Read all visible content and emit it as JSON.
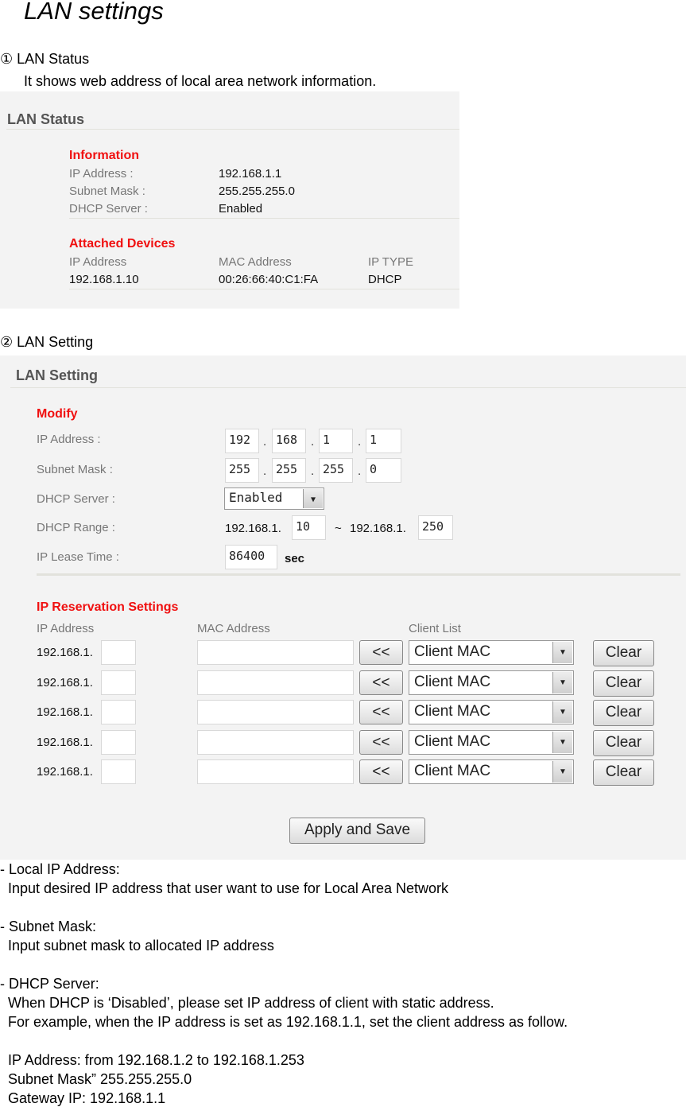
{
  "doc": {
    "title": "LAN settings",
    "sec1": "① LAN Status",
    "sec1_desc": "It shows web address of local area network information.",
    "sec2": "② LAN Setting",
    "notes": [
      "- Local IP Address:",
      "Input desired IP address that user want to use for Local Area Network",
      "- Subnet Mask:",
      "Input subnet mask to allocated IP address",
      "- DHCP Server:",
      "When DHCP is ‘Disabled’, please set IP address of client with static address.",
      "For example, when the IP address is set as 192.168.1.1, set the client address as follow.",
      "IP Address: from 192.168.1.2 to 192.168.1.253",
      "Subnet Mask” 255.255.255.0",
      "Gateway IP: 192.168.1.1"
    ]
  },
  "status": {
    "title": "LAN Status",
    "info_heading": "Information",
    "ip_label": "IP Address :",
    "ip": "192.168.1.1",
    "mask_label": "Subnet Mask :",
    "mask": "255.255.255.0",
    "dhcp_label": "DHCP Server :",
    "dhcp": "Enabled",
    "attached_heading": "Attached Devices",
    "cols": [
      "IP Address",
      "MAC Address",
      "IP TYPE"
    ],
    "device": [
      "192.168.1.10",
      "00:26:66:40:C1:FA",
      "DHCP"
    ]
  },
  "setting": {
    "title": "LAN Setting",
    "modify_heading": "Modify",
    "ip_label": "IP Address :",
    "ip": [
      "192",
      "168",
      "1",
      "1"
    ],
    "mask_label": "Subnet Mask :",
    "mask": [
      "255",
      "255",
      "255",
      "0"
    ],
    "dhcp_label": "DHCP Server :",
    "dhcp": "Enabled",
    "range_label": "DHCP Range :",
    "range_prefix": "192.168.1.",
    "range_start": "10",
    "range_sep": "~",
    "range_end": "250",
    "lease_label": "IP Lease Time :",
    "lease": "86400",
    "lease_unit": "sec",
    "res_heading": "IP Reservation Settings",
    "res_cols": [
      "IP Address",
      "MAC Address",
      "Client List"
    ],
    "res_prefix": "192.168.1.",
    "copy_label": "<<",
    "client_select": "Client MAC",
    "clear_label": "Clear",
    "apply_label": "Apply and Save"
  }
}
